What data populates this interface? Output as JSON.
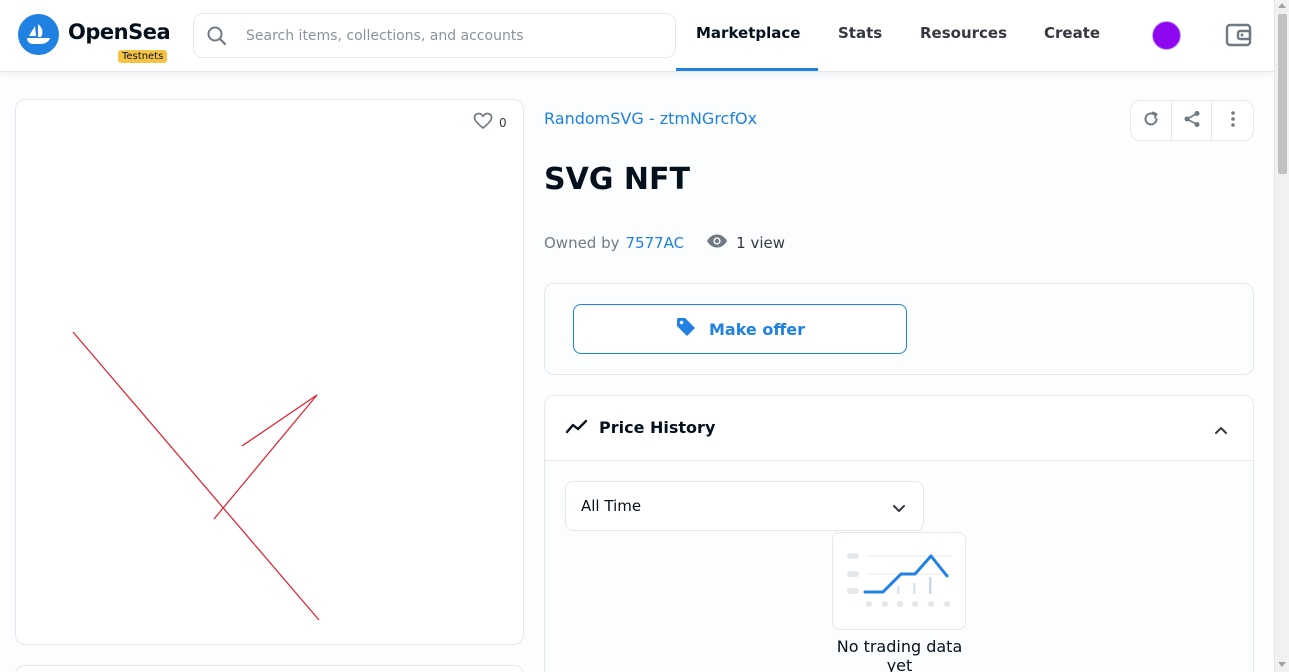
{
  "header": {
    "logo_text": "OpenSea",
    "badge": "Testnets",
    "search_placeholder": "Search items, collections, and accounts",
    "nav": [
      {
        "label": "Marketplace",
        "active": true
      },
      {
        "label": "Stats",
        "active": false
      },
      {
        "label": "Resources",
        "active": false
      },
      {
        "label": "Create",
        "active": false
      }
    ],
    "avatar_color": "#8e07ee",
    "accent_color": "#2081e2"
  },
  "asset": {
    "favorites_count": "0",
    "collection": "RandomSVG - ztmNGrcfOx",
    "title": "SVG NFT",
    "owned_by_label": "Owned by",
    "owner": "7577AC",
    "views": "1 view",
    "image_stroke_color": "#e11d2b"
  },
  "actions": {
    "refresh_icon": "refresh-icon",
    "share_icon": "share-icon",
    "more_icon": "more-vertical-icon"
  },
  "offer": {
    "button_label": "Make offer",
    "icon": "tag-icon"
  },
  "price_history": {
    "title": "Price History",
    "range_selected": "All Time",
    "empty_text": "No trading data yet"
  }
}
